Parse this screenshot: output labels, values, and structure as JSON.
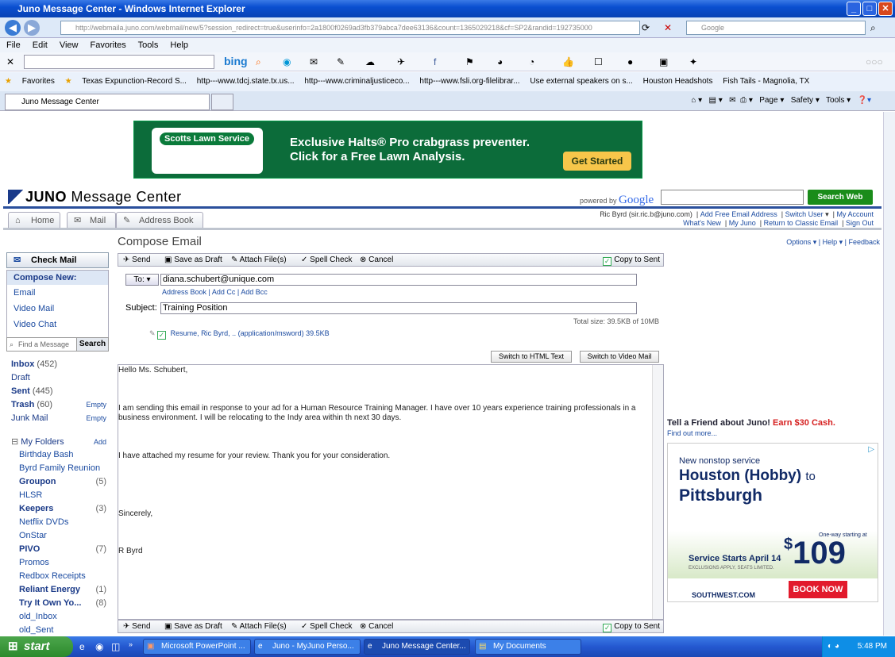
{
  "window": {
    "title": "Juno Message Center - Windows Internet Explorer"
  },
  "browser": {
    "url": "http://webmaila.juno.com/webmail/new/5?session_redirect=true&userinfo=2a1800f0269ad3fb379abca7dee63136&count=1365029218&cf=SP2&randid=192735000",
    "search_placeholder": "Google",
    "menu": [
      "File",
      "Edit",
      "View",
      "Favorites",
      "Tools",
      "Help"
    ],
    "favorites_label": "Favorites",
    "favorites": [
      "Texas Expunction-Record S...",
      "http---www.tdcj.state.tx.us...",
      "http---www.criminaljusticeco...",
      "http---www.fsli.org-filelibrar...",
      "Use external speakers on s...",
      "Houston Headshots",
      "Fish Tails - Magnolia, TX"
    ],
    "tab_title": "Juno Message Center",
    "commands": [
      "Page",
      "Safety",
      "Tools"
    ],
    "bing": "bing"
  },
  "ad_banner": {
    "brand": "Scotts Lawn Service",
    "headline": "Exclusive Halts® Pro crabgrass preventer. Click for a Free Lawn Analysis.",
    "cta": "Get Started"
  },
  "header": {
    "logo_bold": "JUNO",
    "logo_rest": " Message Center",
    "powered_by": "powered by",
    "google": "Google",
    "search_button": "Search Web",
    "tabs": [
      "Home",
      "Mail",
      "Address Book"
    ],
    "user": "Ric Byrd (sir.ric.b@juno.com)",
    "links1": [
      "Add Free Email Address",
      "Switch User",
      "My Account"
    ],
    "links2": [
      "What's New",
      "My Juno",
      "Return to Classic Email",
      "Sign Out"
    ]
  },
  "sidebar": {
    "check_mail": "Check Mail",
    "compose_new": "Compose New:",
    "compose_items": [
      "Email",
      "Video Mail",
      "Video Chat"
    ],
    "find_placeholder": "Find a Message",
    "find_button": "Search",
    "folders": [
      {
        "name": "Inbox",
        "count": "(452)",
        "action": ""
      },
      {
        "name": "Draft",
        "count": "",
        "action": ""
      },
      {
        "name": "Sent",
        "count": "(445)",
        "action": ""
      },
      {
        "name": "Trash",
        "count": "(60)",
        "action": "Empty"
      },
      {
        "name": "Junk Mail",
        "count": "",
        "action": "Empty"
      }
    ],
    "my_folders": "My Folders",
    "add": "Add",
    "subfolders": [
      {
        "name": "Birthday Bash",
        "count": ""
      },
      {
        "name": "Byrd Family Reunion",
        "count": ""
      },
      {
        "name": "Groupon",
        "count": "(5)"
      },
      {
        "name": "HLSR",
        "count": ""
      },
      {
        "name": "Keepers",
        "count": "(3)"
      },
      {
        "name": "Netflix DVDs",
        "count": ""
      },
      {
        "name": "OnStar",
        "count": ""
      },
      {
        "name": "PIVO",
        "count": "(7)"
      },
      {
        "name": "Promos",
        "count": ""
      },
      {
        "name": "Redbox Receipts",
        "count": ""
      },
      {
        "name": "Reliant Energy",
        "count": "(1)"
      },
      {
        "name": "Try It Own Yo...",
        "count": "(8)"
      },
      {
        "name": "old_Inbox",
        "count": ""
      },
      {
        "name": "old_Sent",
        "count": ""
      }
    ]
  },
  "compose": {
    "title": "Compose Email",
    "options": "Options ▾  |  Help ▾  |  Feedback",
    "toolbar": {
      "send": "Send",
      "draft": "Save as Draft",
      "attach": "Attach File(s)",
      "spell": "Spell Check",
      "cancel": "Cancel",
      "copy": "Copy to Sent"
    },
    "to_label": "To:",
    "to": "diana.schubert@unique.com",
    "address_links": "Address Book  |  Add Cc  |  Add Bcc",
    "subject_label": "Subject:",
    "subject": "Training Position",
    "total_size": "Total size:  39.5KB  of  10MB",
    "attachment": "Resume, Ric Byrd, .. (application/msword) 39.5KB",
    "switch_html": "Switch to HTML Text",
    "switch_video": "Switch to Video Mail",
    "body": {
      "greeting": "Hello Ms. Schubert,",
      "p1": "I am sending this email in response to your ad for a Human Resource Training Manager.  I have over 10 years experience training professionals in a business environment.  I will be relocating to the Indy area within th next 30 days.",
      "p2": "I have attached my resume for your review.  Thank you for your consideration.",
      "closing": "Sincerely,",
      "signature": "R Byrd"
    }
  },
  "right_ads": {
    "tell_friend": "Tell a Friend about Juno!",
    "earn": "Earn $30 Cash.",
    "find_more": "Find out more...",
    "sw_line1": "New nonstop service",
    "sw_city1": "Houston (Hobby)",
    "sw_to": "to",
    "sw_city2": "Pittsburgh",
    "sw_one_way": "One-way starting at",
    "sw_price": "109",
    "sw_dollar": "$",
    "sw_starts": "Service Starts April 14",
    "sw_excl": "EXCLUSIONS APPLY, SEATS LIMITED.",
    "sw_logo": "SOUTHWEST.COM",
    "sw_book": "BOOK NOW"
  },
  "taskbar": {
    "start": "start",
    "items": [
      "Microsoft PowerPoint ...",
      "Juno - MyJuno Perso...",
      "Juno Message Center...",
      "My Documents"
    ],
    "time": "5:48 PM"
  }
}
